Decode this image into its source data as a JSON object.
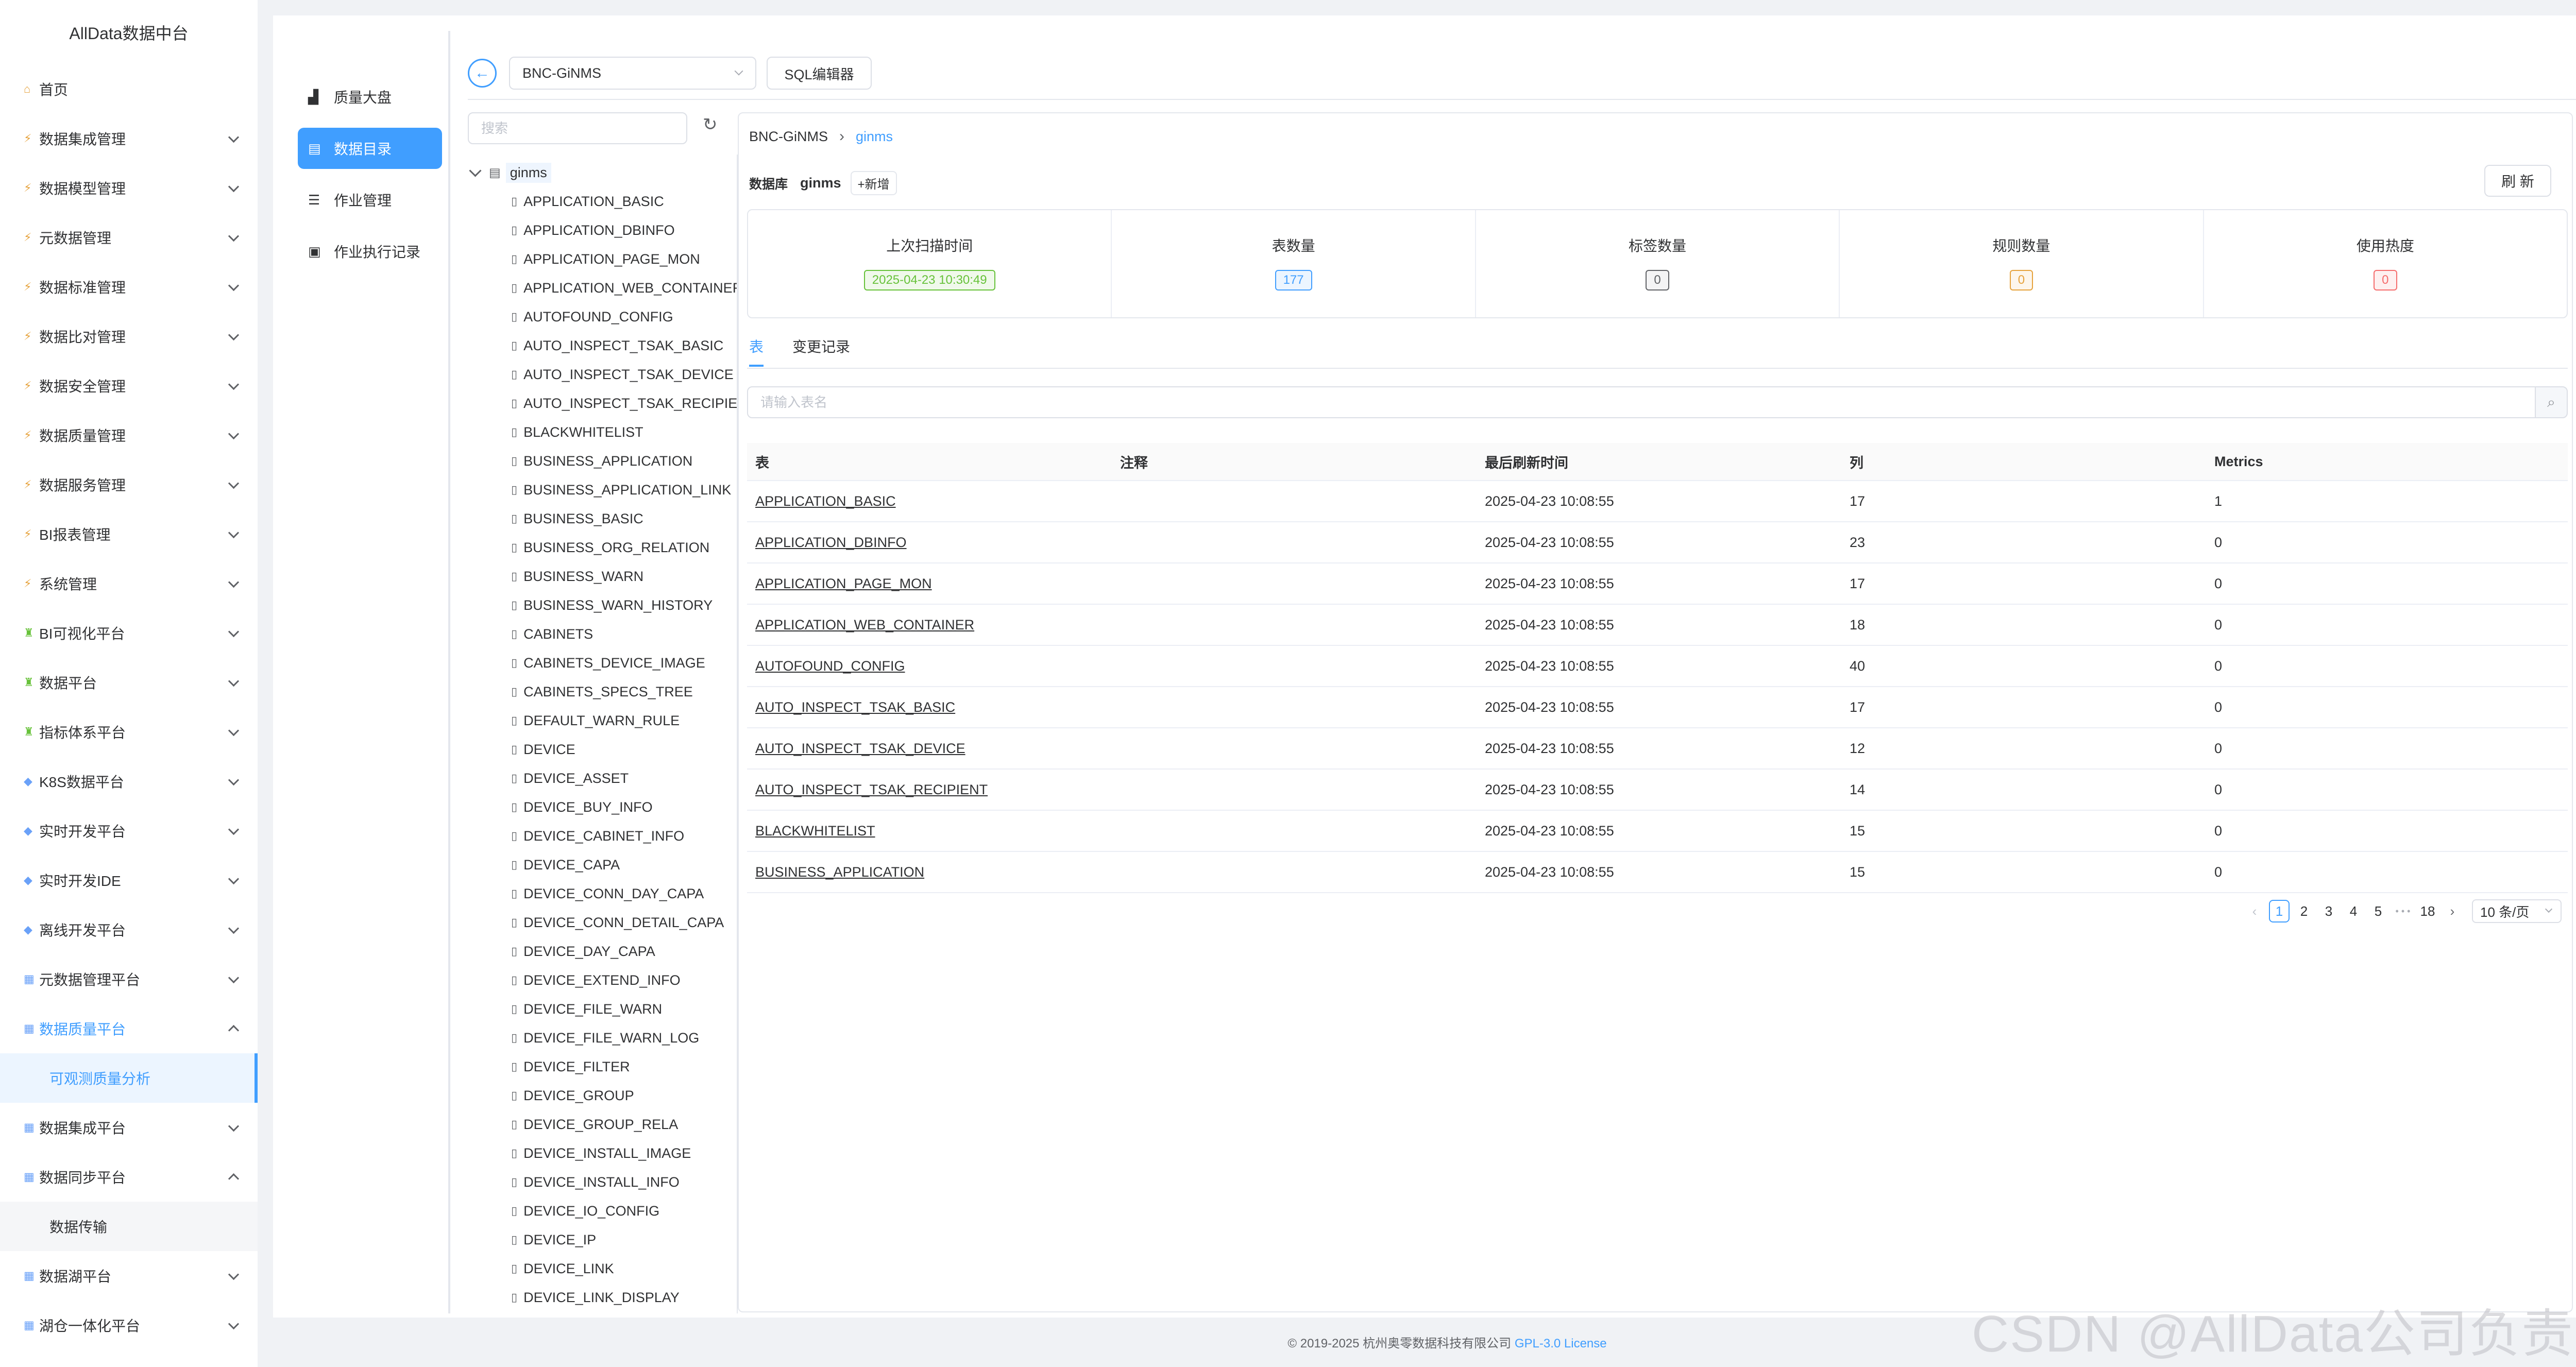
{
  "app_title": "AllData数据中台",
  "sidebar": {
    "items": [
      {
        "label": "首页",
        "icon": "home-icon"
      },
      {
        "label": "数据集成管理",
        "icon": "bolt-icon"
      },
      {
        "label": "数据模型管理",
        "icon": "bolt-icon"
      },
      {
        "label": "元数据管理",
        "icon": "bolt-icon"
      },
      {
        "label": "数据标准管理",
        "icon": "bolt-icon"
      },
      {
        "label": "数据比对管理",
        "icon": "bolt-icon"
      },
      {
        "label": "数据安全管理",
        "icon": "bolt-icon"
      },
      {
        "label": "数据质量管理",
        "icon": "bolt-icon"
      },
      {
        "label": "数据服务管理",
        "icon": "bolt-icon"
      },
      {
        "label": "BI报表管理",
        "icon": "bolt-icon"
      },
      {
        "label": "系统管理",
        "icon": "bolt-icon"
      },
      {
        "label": "BI可视化平台",
        "icon": "platform-icon"
      },
      {
        "label": "数据平台",
        "icon": "platform-icon"
      },
      {
        "label": "指标体系平台",
        "icon": "platform-icon"
      },
      {
        "label": "K8S数据平台",
        "icon": "diamond-icon"
      },
      {
        "label": "实时开发平台",
        "icon": "diamond-icon"
      },
      {
        "label": "实时开发IDE",
        "icon": "diamond-icon"
      },
      {
        "label": "离线开发平台",
        "icon": "diamond-icon"
      },
      {
        "label": "元数据管理平台",
        "icon": "grid-icon"
      },
      {
        "label": "数据质量平台",
        "icon": "grid-icon"
      },
      {
        "label": "可观测质量分析",
        "icon": ""
      },
      {
        "label": "数据集成平台",
        "icon": "grid-icon"
      },
      {
        "label": "数据同步平台",
        "icon": "grid-icon"
      },
      {
        "label": "数据传输",
        "icon": ""
      },
      {
        "label": "数据湖平台",
        "icon": "grid-icon"
      },
      {
        "label": "湖仓一体化平台",
        "icon": "grid-icon"
      }
    ]
  },
  "sub_menu": [
    {
      "label": "质量大盘",
      "icon": "chart-icon"
    },
    {
      "label": "数据目录",
      "icon": "document-icon"
    },
    {
      "label": "作业管理",
      "icon": "list-icon"
    },
    {
      "label": "作业执行记录",
      "icon": "record-icon"
    }
  ],
  "toolbar": {
    "back_icon": "back-arrow-icon",
    "datasource": "BNC-GiNMS",
    "sql_editor": "SQL编辑器"
  },
  "tree": {
    "search_placeholder": "搜索",
    "root": "ginms",
    "nodes": [
      "APPLICATION_BASIC",
      "APPLICATION_DBINFO",
      "APPLICATION_PAGE_MON",
      "APPLICATION_WEB_CONTAINER",
      "AUTOFOUND_CONFIG",
      "AUTO_INSPECT_TSAK_BASIC",
      "AUTO_INSPECT_TSAK_DEVICE",
      "AUTO_INSPECT_TSAK_RECIPIENT",
      "BLACKWHITELIST",
      "BUSINESS_APPLICATION",
      "BUSINESS_APPLICATION_LINK",
      "BUSINESS_BASIC",
      "BUSINESS_ORG_RELATION",
      "BUSINESS_WARN",
      "BUSINESS_WARN_HISTORY",
      "CABINETS",
      "CABINETS_DEVICE_IMAGE",
      "CABINETS_SPECS_TREE",
      "DEFAULT_WARN_RULE",
      "DEVICE",
      "DEVICE_ASSET",
      "DEVICE_BUY_INFO",
      "DEVICE_CABINET_INFO",
      "DEVICE_CAPA",
      "DEVICE_CONN_DAY_CAPA",
      "DEVICE_CONN_DETAIL_CAPA",
      "DEVICE_DAY_CAPA",
      "DEVICE_EXTEND_INFO",
      "DEVICE_FILE_WARN",
      "DEVICE_FILE_WARN_LOG",
      "DEVICE_FILTER",
      "DEVICE_GROUP",
      "DEVICE_GROUP_RELA",
      "DEVICE_INSTALL_IMAGE",
      "DEVICE_INSTALL_INFO",
      "DEVICE_IO_CONFIG",
      "DEVICE_IP",
      "DEVICE_LINK",
      "DEVICE_LINK_DISPLAY"
    ]
  },
  "detail": {
    "breadcrumb": [
      "BNC-GiNMS",
      "ginms"
    ],
    "db_label": "数据库",
    "db_name": "ginms",
    "add_label": "+新增",
    "refresh_label": "刷 新",
    "stats": [
      {
        "label": "上次扫描时间",
        "value": "2025-04-23 10:30:49"
      },
      {
        "label": "表数量",
        "value": "177"
      },
      {
        "label": "标签数量",
        "value": "0"
      },
      {
        "label": "规则数量",
        "value": "0"
      },
      {
        "label": "使用热度",
        "value": "0"
      }
    ],
    "tabs": [
      "表",
      "变更记录"
    ],
    "table_search_placeholder": "请输入表名",
    "columns": [
      "表",
      "注释",
      "最后刷新时间",
      "列",
      "Metrics"
    ],
    "rows": [
      {
        "name": "APPLICATION_BASIC",
        "comment": "",
        "time": "2025-04-23 10:08:55",
        "cols": "17",
        "metrics": "1"
      },
      {
        "name": "APPLICATION_DBINFO",
        "comment": "",
        "time": "2025-04-23 10:08:55",
        "cols": "23",
        "metrics": "0"
      },
      {
        "name": "APPLICATION_PAGE_MON",
        "comment": "",
        "time": "2025-04-23 10:08:55",
        "cols": "17",
        "metrics": "0"
      },
      {
        "name": "APPLICATION_WEB_CONTAINER",
        "comment": "",
        "time": "2025-04-23 10:08:55",
        "cols": "18",
        "metrics": "0"
      },
      {
        "name": "AUTOFOUND_CONFIG",
        "comment": "",
        "time": "2025-04-23 10:08:55",
        "cols": "40",
        "metrics": "0"
      },
      {
        "name": "AUTO_INSPECT_TSAK_BASIC",
        "comment": "",
        "time": "2025-04-23 10:08:55",
        "cols": "17",
        "metrics": "0"
      },
      {
        "name": "AUTO_INSPECT_TSAK_DEVICE",
        "comment": "",
        "time": "2025-04-23 10:08:55",
        "cols": "12",
        "metrics": "0"
      },
      {
        "name": "AUTO_INSPECT_TSAK_RECIPIENT",
        "comment": "",
        "time": "2025-04-23 10:08:55",
        "cols": "14",
        "metrics": "0"
      },
      {
        "name": "BLACKWHITELIST",
        "comment": "",
        "time": "2025-04-23 10:08:55",
        "cols": "15",
        "metrics": "0"
      },
      {
        "name": "BUSINESS_APPLICATION",
        "comment": "",
        "time": "2025-04-23 10:08:55",
        "cols": "15",
        "metrics": "0"
      }
    ],
    "pagination": {
      "pages": [
        "1",
        "2",
        "3",
        "4",
        "5"
      ],
      "ellipsis": "• • •",
      "last": "18",
      "current": "1",
      "page_size": "10 条/页"
    }
  },
  "footer": {
    "copyright": "© 2019-2025 杭州奥零数据科技有限公司",
    "license": "GPL-3.0 License"
  },
  "watermark": "CSDN @AllData公司负责人"
}
